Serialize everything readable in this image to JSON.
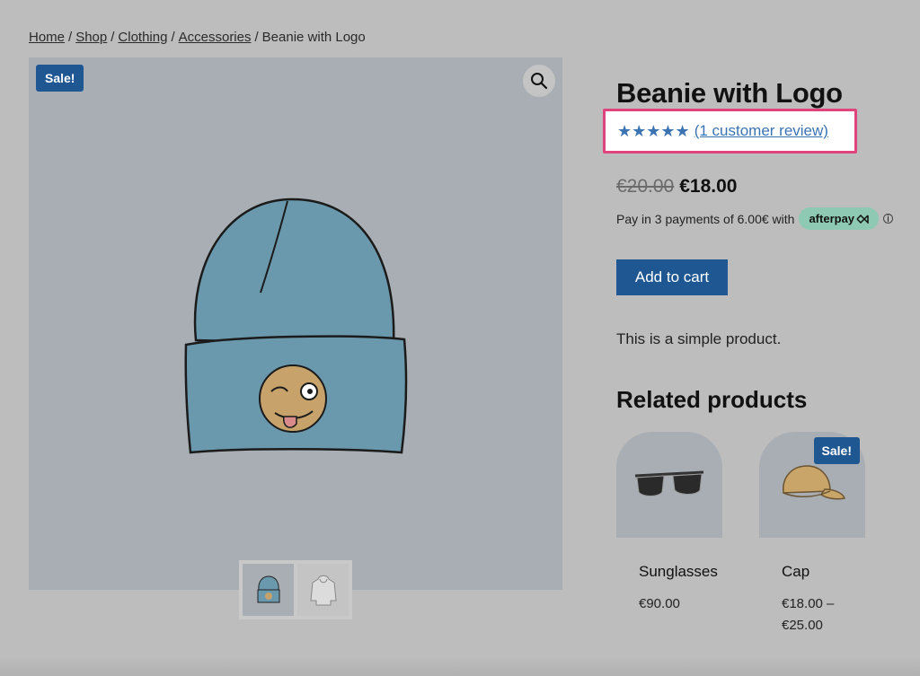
{
  "breadcrumb": {
    "home": "Home",
    "shop": "Shop",
    "clothing": "Clothing",
    "accessories": "Accessories",
    "current": "Beanie with Logo",
    "separator": "/"
  },
  "gallery": {
    "sale_badge": "Sale!",
    "zoom_icon": "search-icon"
  },
  "product": {
    "title": "Beanie with Logo",
    "stars": "★★★★★",
    "rating": 5,
    "review_link": "(1 customer review)",
    "old_price": "€20.00",
    "new_price": "€18.00",
    "afterpay_text": "Pay in 3 payments of 6.00€ with",
    "afterpay_brand": "afterpay",
    "afterpay_info": "i",
    "add_to_cart": "Add to cart",
    "description": "This is a simple product."
  },
  "related": {
    "title": "Related products",
    "items": [
      {
        "name": "Sunglasses",
        "price_line1": "€90.00",
        "price_line2": ""
      },
      {
        "name": "Cap",
        "price_line1": "€18.00 –",
        "price_line2": "€25.00",
        "badge": "Sale!"
      }
    ]
  },
  "colors": {
    "accent": "#1f5793",
    "link": "#3b73b3",
    "highlight": "#e0447c",
    "afterpay": "#8ec9b4"
  }
}
